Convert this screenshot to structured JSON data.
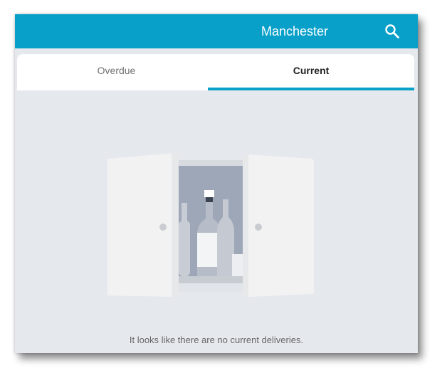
{
  "header": {
    "title": "Manchester",
    "search_icon": "search-icon",
    "background_color": "#08a0c9"
  },
  "tabs": [
    {
      "label": "Overdue",
      "selected": false
    },
    {
      "label": "Current",
      "selected": true
    }
  ],
  "accent_color": "#0aa1c8",
  "empty_state": {
    "illustration_icon": "empty-cabinet-illustration",
    "message": "It looks like there are no current deliveries."
  }
}
